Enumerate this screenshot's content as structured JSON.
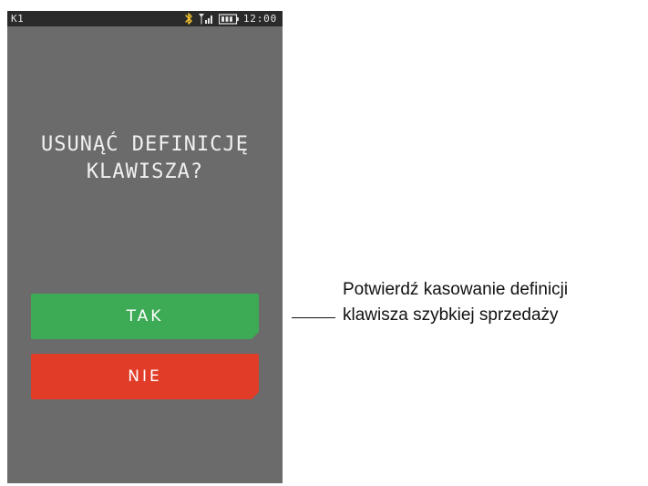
{
  "status_bar": {
    "left_label": "K1",
    "time": "12:00",
    "icons": [
      "bluetooth-icon",
      "signal-icon",
      "battery-icon"
    ]
  },
  "dialog": {
    "title_line1": "USUNĄĆ DEFINICJĘ",
    "title_line2": "KLAWISZA?"
  },
  "buttons": {
    "yes": "TAK",
    "no": "NIE"
  },
  "annotation": {
    "line1": "Potwierdź kasowanie definicji",
    "line2": "klawisza szybkiej sprzedaży"
  },
  "colors": {
    "screen_bg": "#6b6b6b",
    "status_bg": "#2a2a2a",
    "yes_button": "#3daa55",
    "no_button": "#e13c28",
    "bluetooth_icon": "#f2c12e"
  }
}
